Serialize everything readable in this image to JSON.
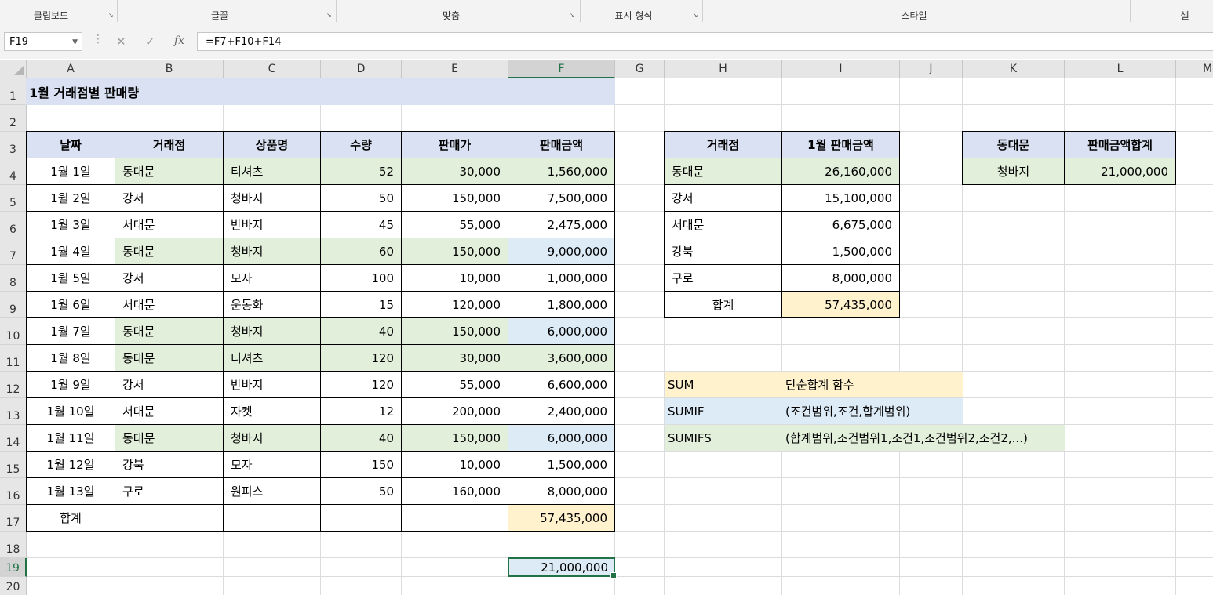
{
  "ribbon": {
    "groups": [
      {
        "label": "클립보드"
      },
      {
        "label": "글꼴"
      },
      {
        "label": "맞춤"
      },
      {
        "label": "표시 형식"
      },
      {
        "label": "스타일"
      },
      {
        "label": "셀"
      }
    ]
  },
  "formula_bar": {
    "name_box": "F19",
    "formula": "=F7+F10+F14",
    "cancel_icon": "✕",
    "enter_icon": "✓",
    "fx_icon": "fx"
  },
  "columns": [
    "A",
    "B",
    "C",
    "D",
    "E",
    "F",
    "G",
    "H",
    "I",
    "J",
    "K",
    "L",
    "M"
  ],
  "rows": [
    "1",
    "2",
    "3",
    "4",
    "5",
    "6",
    "7",
    "8",
    "9",
    "10",
    "11",
    "12",
    "13",
    "14",
    "15",
    "16",
    "17",
    "18",
    "19",
    "20"
  ],
  "sheet": {
    "title": "1월 거래점별 판매량",
    "main_table": {
      "headers": [
        "날짜",
        "거래점",
        "상품명",
        "수량",
        "판매가",
        "판매금액"
      ],
      "rows": [
        [
          "1월 1일",
          "동대문",
          "티셔츠",
          "52",
          "30,000",
          "1,560,000"
        ],
        [
          "1월 2일",
          "강서",
          "청바지",
          "50",
          "150,000",
          "7,500,000"
        ],
        [
          "1월 3일",
          "서대문",
          "반바지",
          "45",
          "55,000",
          "2,475,000"
        ],
        [
          "1월 4일",
          "동대문",
          "청바지",
          "60",
          "150,000",
          "9,000,000"
        ],
        [
          "1월 5일",
          "강서",
          "모자",
          "100",
          "10,000",
          "1,000,000"
        ],
        [
          "1월 6일",
          "서대문",
          "운동화",
          "15",
          "120,000",
          "1,800,000"
        ],
        [
          "1월 7일",
          "동대문",
          "청바지",
          "40",
          "150,000",
          "6,000,000"
        ],
        [
          "1월 8일",
          "동대문",
          "티셔츠",
          "120",
          "30,000",
          "3,600,000"
        ],
        [
          "1월 9일",
          "강서",
          "반바지",
          "120",
          "55,000",
          "6,600,000"
        ],
        [
          "1월 10일",
          "서대문",
          "자켓",
          "12",
          "200,000",
          "2,400,000"
        ],
        [
          "1월 11일",
          "동대문",
          "청바지",
          "40",
          "150,000",
          "6,000,000"
        ],
        [
          "1월 12일",
          "강북",
          "모자",
          "150",
          "10,000",
          "1,500,000"
        ],
        [
          "1월 13일",
          "구로",
          "원피스",
          "50",
          "160,000",
          "8,000,000"
        ]
      ],
      "total_label": "합계",
      "total_value": "57,435,000",
      "f19_value": "21,000,000"
    },
    "store_table": {
      "headers": [
        "거래점",
        "1월 판매금액"
      ],
      "rows": [
        [
          "동대문",
          "26,160,000"
        ],
        [
          "강서",
          "15,100,000"
        ],
        [
          "서대문",
          "6,675,000"
        ],
        [
          "강북",
          "1,500,000"
        ],
        [
          "구로",
          "8,000,000"
        ]
      ],
      "total_label": "합계",
      "total_value": "57,435,000"
    },
    "small_table": {
      "headers": [
        "동대문",
        "판매금액합계"
      ],
      "row": [
        "청바지",
        "21,000,000"
      ]
    },
    "notes": [
      {
        "func": "SUM",
        "desc": "단순합계 함수"
      },
      {
        "func": "SUMIF",
        "desc": "(조건범위,조건,합계범위)"
      },
      {
        "func": "SUMIFS",
        "desc": "(합계범위,조건범위1,조건1,조건범위2,조건2,...)"
      }
    ]
  },
  "colors": {
    "header_fill": "#d9e1f2",
    "green_fill": "#e2efda",
    "blue_fill": "#ddebf7",
    "yellow_fill": "#fff2cc",
    "selection": "#217346"
  }
}
